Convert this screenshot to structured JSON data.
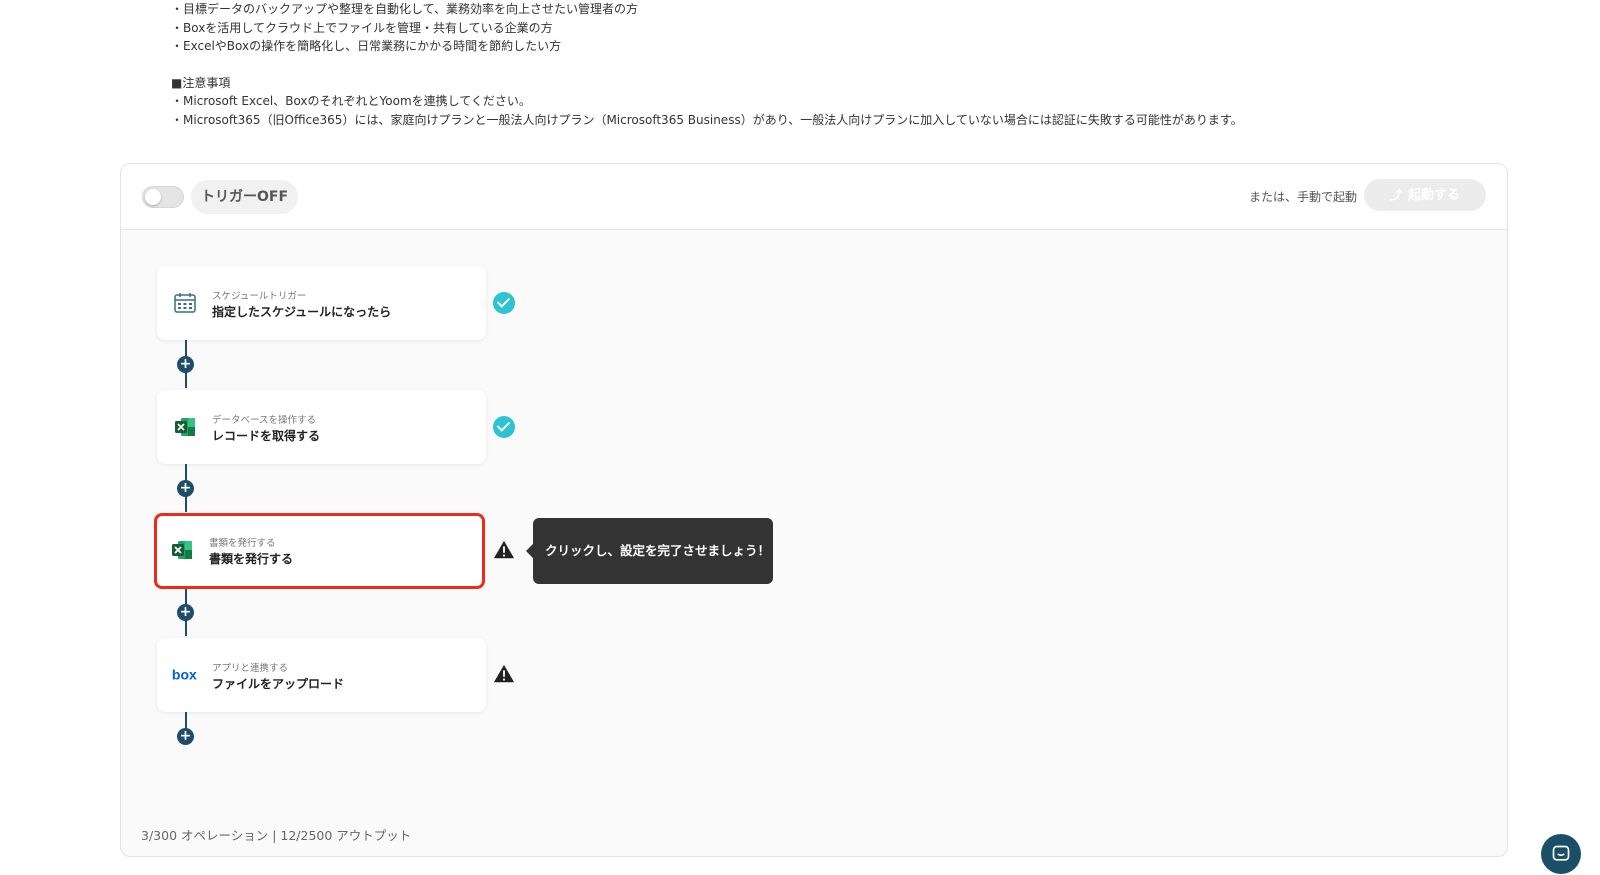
{
  "description": {
    "lines": [
      "・目標データのバックアップや整理を自動化して、業務効率を向上させたい管理者の方",
      "・Boxを活用してクラウド上でファイルを管理・共有している企業の方",
      "・ExcelやBoxの操作を簡略化し、日常業務にかかる時間を節約したい方"
    ],
    "notes_heading": "■注意事項",
    "notes": [
      "・Microsoft Excel、BoxのそれぞれとYoomを連携してください。",
      "・Microsoft365（旧Office365）には、家庭向けプランと一般法人向けプラン（Microsoft365 Business）があり、一般法人向けプランに加入していない場合には認証に失敗する可能性があります。"
    ]
  },
  "header": {
    "trigger_label": "トリガーOFF",
    "manual_text": "または、手動で起動",
    "start_label": "起動する"
  },
  "flow": [
    {
      "sub": "スケジュールトリガー",
      "main": "指定したスケジュールになったら",
      "icon": "calendar-icon",
      "status": "complete"
    },
    {
      "sub": "データベースを操作する",
      "main": "レコードを取得する",
      "icon": "excel-icon",
      "status": "complete"
    },
    {
      "sub": "書類を発行する",
      "main": "書類を発行する",
      "icon": "excel-icon",
      "status": "warning"
    },
    {
      "sub": "アプリと連携する",
      "main": "ファイルをアップロード",
      "icon": "box-icon",
      "status": "warning"
    }
  ],
  "tooltip": {
    "text": "クリックし、設定を完了させましょう！"
  },
  "footer": {
    "stats": "3/300 オペレーション | 12/2500 アウトプット"
  },
  "colors": {
    "accent": "#1e4d6b",
    "check": "#2cc3d3",
    "highlight": "#ee2a1a",
    "excel": "#1d7044",
    "box": "#0061d5"
  }
}
